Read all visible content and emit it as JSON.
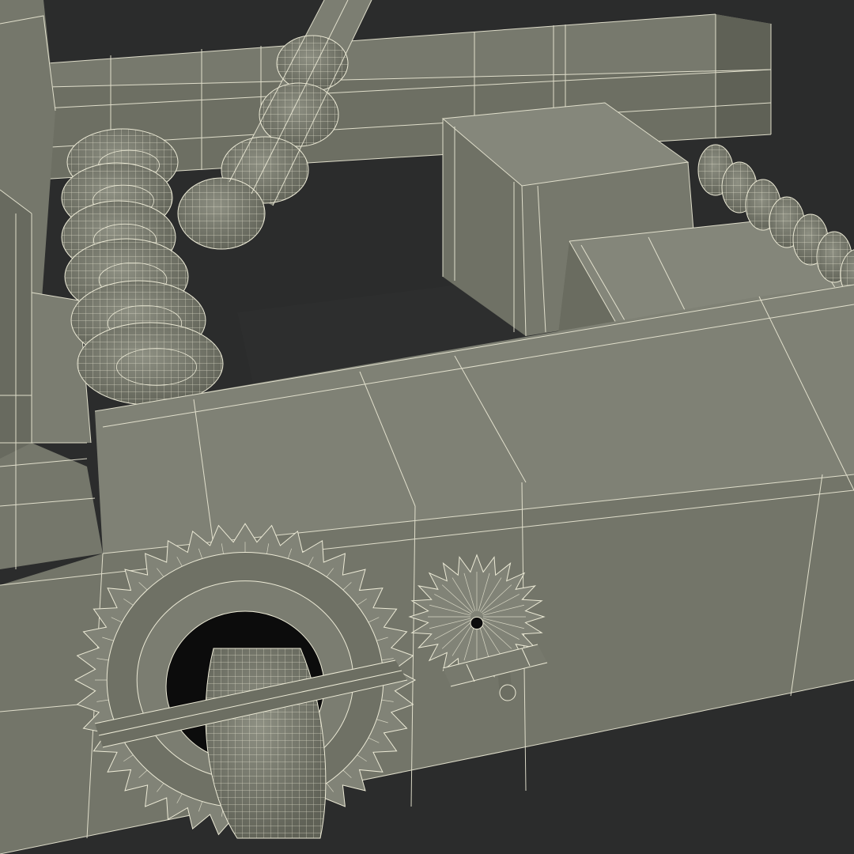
{
  "render": {
    "background": "#2b2c2c",
    "surface_colors": {
      "top": "#7d7f72",
      "side": "#6a6c60",
      "dark": "#5a5c51",
      "light": "#8a8c80",
      "hole": "#0c0c0c"
    },
    "wire_color": "#ecead6"
  },
  "objects": [
    {
      "name": "back-beam",
      "kind": "beam"
    },
    {
      "name": "front-beam",
      "kind": "beam"
    },
    {
      "name": "left-post",
      "kind": "beam"
    },
    {
      "name": "rear-block",
      "kind": "block"
    },
    {
      "name": "right-block",
      "kind": "block"
    },
    {
      "name": "twisted-rope",
      "kind": "rope"
    },
    {
      "name": "coiled-spring-left",
      "kind": "spring"
    },
    {
      "name": "coiled-spring-right",
      "kind": "spring"
    },
    {
      "name": "large-gear",
      "kind": "gear"
    },
    {
      "name": "small-gear",
      "kind": "gear"
    },
    {
      "name": "axle-rod",
      "kind": "rod"
    },
    {
      "name": "rope-loop",
      "kind": "rope"
    },
    {
      "name": "pin-rod",
      "kind": "rod"
    }
  ]
}
